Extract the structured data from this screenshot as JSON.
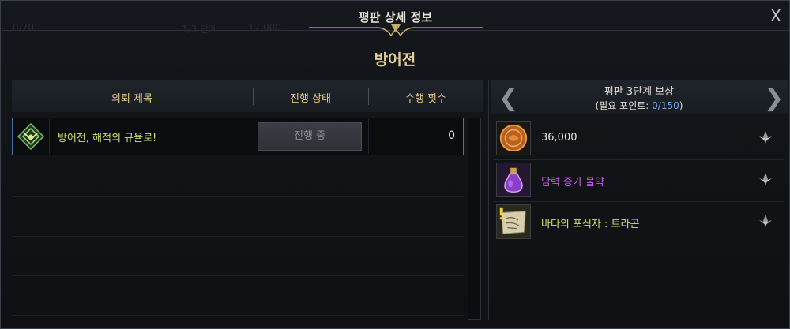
{
  "window": {
    "title": "평판 상세 정보",
    "close_label": "X",
    "category": "방어전"
  },
  "background": {
    "ghost_texts": [
      "0/70",
      "1/3 단계",
      "17,000"
    ]
  },
  "table": {
    "headers": [
      "의뢰 제목",
      "진행 상태",
      "수행 횟수"
    ],
    "rows": [
      {
        "icon": "quest-crest-icon",
        "title": "방어전, 해적의 규율로!",
        "status": "진행 중",
        "count": "0"
      }
    ]
  },
  "rewards": {
    "title": "평판 3단계 보상",
    "points_prefix": "(필요 포인트: ",
    "points_current": "0",
    "points_sep": "/150",
    "points_suffix": ")",
    "items": [
      {
        "name": "36,000",
        "icon": "silver-coin-icon",
        "color": "#e6e6e6"
      },
      {
        "name": "담력 증가 물약",
        "icon": "potion-icon",
        "color": "#c95cf0"
      },
      {
        "name": "바다의 포식자 : 트라곤",
        "icon": "map-scroll-icon",
        "color": "#cbe26a"
      }
    ]
  },
  "colors": {
    "header_gold": "#e2c886",
    "selected_border": "#4b6fa0",
    "points_blue": "#6ea7e8"
  }
}
